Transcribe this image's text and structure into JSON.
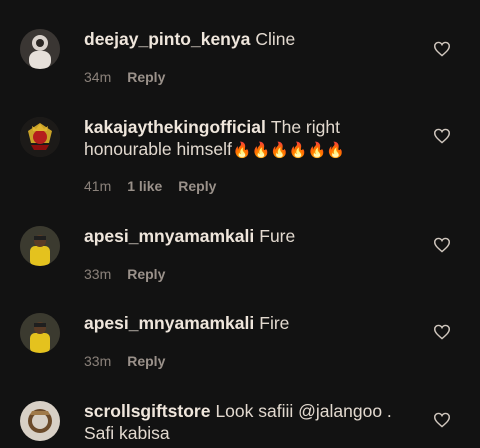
{
  "comments": [
    {
      "username": "deejay_pinto_kenya",
      "text": "Cline",
      "time": "34m",
      "likes": "",
      "reply": "Reply"
    },
    {
      "username": "kakajaythekingofficial",
      "text": "The right honourable himself",
      "emoji": "🔥🔥🔥🔥🔥🔥",
      "time": "41m",
      "likes": "1 like",
      "reply": "Reply"
    },
    {
      "username": "apesi_mnyamamkali",
      "text": "Fure",
      "time": "33m",
      "likes": "",
      "reply": "Reply"
    },
    {
      "username": "apesi_mnyamamkali",
      "text": "Fire",
      "time": "33m",
      "likes": "",
      "reply": "Reply"
    },
    {
      "username": "scrollsgiftstore",
      "text": "Look safiii @jalangoo . Safi kabisa",
      "time": "",
      "likes": "",
      "reply": ""
    }
  ],
  "colors": {
    "background": "#121212",
    "username": "#efe6dc",
    "meta": "#8a817a",
    "heart": "#cfc6bd"
  }
}
